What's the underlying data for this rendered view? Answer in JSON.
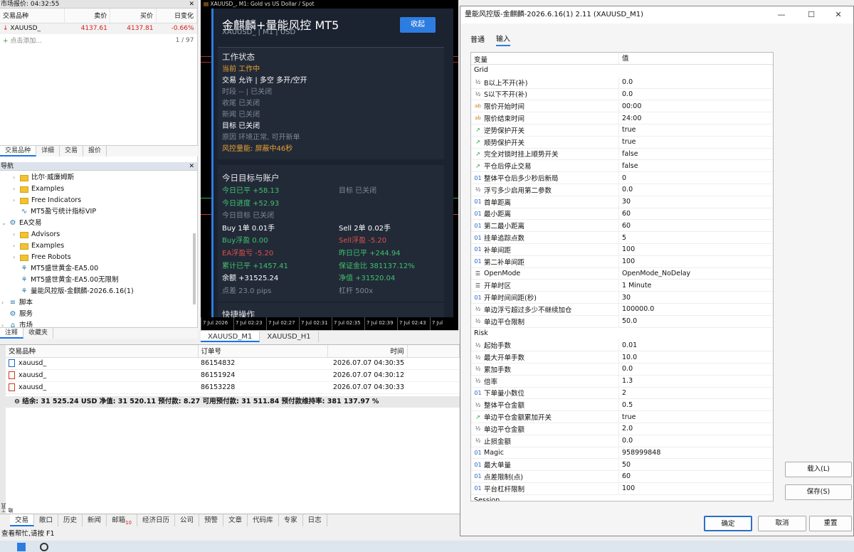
{
  "market_watch": {
    "title": "市场报价: 04:32:55",
    "columns": [
      "交易品种",
      "卖价",
      "买价",
      "日变化"
    ],
    "rows": [
      {
        "symbol": "XAUUSD_",
        "bid": "4137.61",
        "ask": "4137.81",
        "change": "-0.66%"
      }
    ],
    "add_placeholder": "点击添加...",
    "count": "1 / 97",
    "tabs": [
      "交易品种",
      "详细",
      "交易",
      "报价"
    ]
  },
  "navigator": {
    "title": "导航",
    "items": [
      {
        "label": "比尔·威廉姆斯",
        "type": "folder",
        "indent": 2
      },
      {
        "label": "Examples",
        "type": "folder",
        "indent": 2
      },
      {
        "label": "Free Indicators",
        "type": "folder",
        "indent": 2
      },
      {
        "label": "MT5盈亏统计指标VIP",
        "type": "indicator",
        "indent": 2
      },
      {
        "label": "EA交易",
        "type": "ea-root",
        "indent": 0
      },
      {
        "label": "Advisors",
        "type": "folder",
        "indent": 2
      },
      {
        "label": "Examples",
        "type": "folder",
        "indent": 2
      },
      {
        "label": "Free Robots",
        "type": "folder",
        "indent": 2
      },
      {
        "label": "MT5盛世黄金-EA5.00",
        "type": "ea",
        "indent": 2
      },
      {
        "label": "MT5盛世黄金-EA5.00无限制",
        "type": "ea",
        "indent": 2
      },
      {
        "label": "量能风控版-金麒麟-2026.6.16(1)",
        "type": "ea",
        "indent": 2
      },
      {
        "label": "脚本",
        "type": "script",
        "indent": 0
      },
      {
        "label": "服务",
        "type": "service",
        "indent": 0
      },
      {
        "label": "市场",
        "type": "market",
        "indent": 0
      }
    ],
    "tabs": [
      "注释",
      "收藏夹"
    ]
  },
  "chart": {
    "title": "XAUUSD_, M1: Gold vs US Dollar / Spot",
    "x_ticks": [
      "7 Jul 2026",
      "7 Jul 02:23",
      "7 Jul 02:27",
      "7 Jul 02:31",
      "7 Jul 02:35",
      "7 Jul 02:39",
      "7 Jul 02:43",
      "7 Jul"
    ],
    "tabs": [
      "XAUUSD_M1",
      "XAUUSD_H1"
    ],
    "panel": {
      "title": "金麒麟+量能风控 MT5",
      "subtitle": "XAUUSD_  |  M1  |  USD",
      "collapse_label": "收起",
      "status_head": "工作状态",
      "status_lines": [
        {
          "text": "当前  工作中",
          "style": "orange"
        },
        {
          "text": "交易  允许  |  多空  多开/空开",
          "style": "white"
        },
        {
          "text": "时段  --  |  已关闭",
          "style": "dim"
        },
        {
          "text": "收尾  已关闭",
          "style": "dim"
        },
        {
          "text": "新闻  已关闭",
          "style": "dim"
        },
        {
          "text": "目标  已关闭",
          "style": "white"
        },
        {
          "text": "原因  环境正常, 可开新单",
          "style": "dim"
        },
        {
          "text": "风控量能: 屏蔽中46秒",
          "style": "orange"
        }
      ],
      "account_head": "今日目标与账户",
      "account_rows": [
        {
          "l": "今日已平  +58.13",
          "ls": "green",
          "r": "目标  已关闭",
          "rs": "dim"
        },
        {
          "l": "今日进度  +52.93",
          "ls": "green",
          "r": "",
          "rs": "dim"
        },
        {
          "l": "今日目标  已关闭",
          "ls": "dim",
          "r": "",
          "rs": "dim"
        },
        {
          "l": "Buy  1单  0.01手",
          "ls": "white",
          "r": "Sell  2单  0.02手",
          "rs": "white"
        },
        {
          "l": "Buy浮盈  0.00",
          "ls": "green",
          "r": "Sell浮盈  -5.20",
          "rs": "red"
        },
        {
          "l": "EA浮盈亏  -5.20",
          "ls": "red",
          "r": "昨日已平  +244.94",
          "rs": "green"
        },
        {
          "l": "累计已平  +1457.41",
          "ls": "green",
          "r": "保证金比  381137.12%",
          "rs": "green"
        },
        {
          "l": "余额  +31525.24",
          "ls": "white",
          "r": "净值  +31520.04",
          "rs": "green"
        },
        {
          "l": "点差  23.0 pips",
          "ls": "dim",
          "r": "杠杆  500x",
          "rs": "dim"
        }
      ],
      "quick_head": "快捷操作"
    }
  },
  "toolbox": {
    "columns": [
      "交易品种",
      "订单号",
      "时间"
    ],
    "rows": [
      {
        "symbol": "xauusd_",
        "ticket": "86154832",
        "time": "2026.07.07 04:30:35",
        "side": "buy"
      },
      {
        "symbol": "xauusd_",
        "ticket": "86151924",
        "time": "2026.07.07 04:30:12",
        "side": "sell"
      },
      {
        "symbol": "xauusd_",
        "ticket": "86153228",
        "time": "2026.07.07 04:30:33",
        "side": "sell"
      }
    ],
    "balance_line": "结余: 31 525.24 USD  净值: 31 520.11  预付款: 8.27  可用预付款: 31 511.84  预付款维持率: 381 137.97 %",
    "tabs": [
      "交易",
      "敞口",
      "历史",
      "新闻",
      "邮箱",
      "经济日历",
      "公司",
      "预警",
      "文章",
      "代码库",
      "专家",
      "日志"
    ],
    "mail_badge": "10",
    "side_label": "工具箱",
    "status": "查看帮忙,请按 F1"
  },
  "dialog": {
    "title": "量能风控版-金麒麟-2026.6.16(1) 2.11 (XAUUSD_M1)",
    "tabs": [
      "普通",
      "输入"
    ],
    "active_tab": 1,
    "grid_headers": [
      "变量",
      "值"
    ],
    "rows": [
      {
        "cat": "Grid"
      },
      {
        "type": "half",
        "name": "B以上不开(补)",
        "value": "0.0"
      },
      {
        "type": "half",
        "name": "S以下不开(补)",
        "value": "0.0"
      },
      {
        "type": "ab",
        "name": "限价开始时间",
        "value": "00:00"
      },
      {
        "type": "ab",
        "name": "限价结束时间",
        "value": "24:00"
      },
      {
        "type": "bool",
        "name": "逆势保护开关",
        "value": "true"
      },
      {
        "type": "bool",
        "name": "顺势保护开关",
        "value": "true"
      },
      {
        "type": "bool",
        "name": "完全对锁时挂上顺势开关",
        "value": "false"
      },
      {
        "type": "bool",
        "name": "平仓后停止交易",
        "value": "false"
      },
      {
        "type": "num",
        "name": "整体平仓后多少秒后新局",
        "value": "0"
      },
      {
        "type": "half",
        "name": "浮亏多少启用第二参数",
        "value": "0.0"
      },
      {
        "type": "num",
        "name": "首单距离",
        "value": "30"
      },
      {
        "type": "num",
        "name": "最小距离",
        "value": "60"
      },
      {
        "type": "num",
        "name": "第二最小距离",
        "value": "60"
      },
      {
        "type": "num",
        "name": "挂单追踪点数",
        "value": "5"
      },
      {
        "type": "num",
        "name": "补单间距",
        "value": "100"
      },
      {
        "type": "num",
        "name": "第二补单间距",
        "value": "100"
      },
      {
        "type": "enum",
        "name": "OpenMode",
        "value": "OpenMode_NoDelay"
      },
      {
        "type": "enum",
        "name": "开单时区",
        "value": "1 Minute"
      },
      {
        "type": "num",
        "name": "开单时间间距(秒)",
        "value": "30"
      },
      {
        "type": "half",
        "name": "单边浮亏超过多少不继续加仓",
        "value": "100000.0"
      },
      {
        "type": "half",
        "name": "单边平仓限制",
        "value": "50.0"
      },
      {
        "cat": "Risk"
      },
      {
        "type": "half",
        "name": "起始手数",
        "value": "0.01"
      },
      {
        "type": "half",
        "name": "最大开单手数",
        "value": "10.0"
      },
      {
        "type": "half",
        "name": "累加手数",
        "value": "0.0"
      },
      {
        "type": "half",
        "name": "倍率",
        "value": "1.3"
      },
      {
        "type": "num",
        "name": "下单量小数位",
        "value": "2"
      },
      {
        "type": "half",
        "name": "整体平仓金额",
        "value": "0.5"
      },
      {
        "type": "bool",
        "name": "单边平仓金额累加开关",
        "value": "true"
      },
      {
        "type": "half",
        "name": "单边平仓金额",
        "value": "2.0"
      },
      {
        "type": "half",
        "name": "止损金额",
        "value": "0.0"
      },
      {
        "type": "num",
        "name": "Magic",
        "value": "958999848"
      },
      {
        "type": "num",
        "name": "最大单量",
        "value": "50"
      },
      {
        "type": "num",
        "name": "点差限制(点)",
        "value": "60"
      },
      {
        "type": "num",
        "name": "平台杠杆限制",
        "value": "100"
      },
      {
        "cat": "Session"
      }
    ],
    "load_label": "载入(L)",
    "save_label": "保存(S)",
    "ok_label": "确定",
    "cancel_label": "取消",
    "reset_label": "重置"
  },
  "colors": {
    "panel_bg": "#1b2230",
    "accent": "#2d7de0",
    "positive": "#3fc26d",
    "negative": "#e0504a",
    "warning": "#e8a030"
  }
}
